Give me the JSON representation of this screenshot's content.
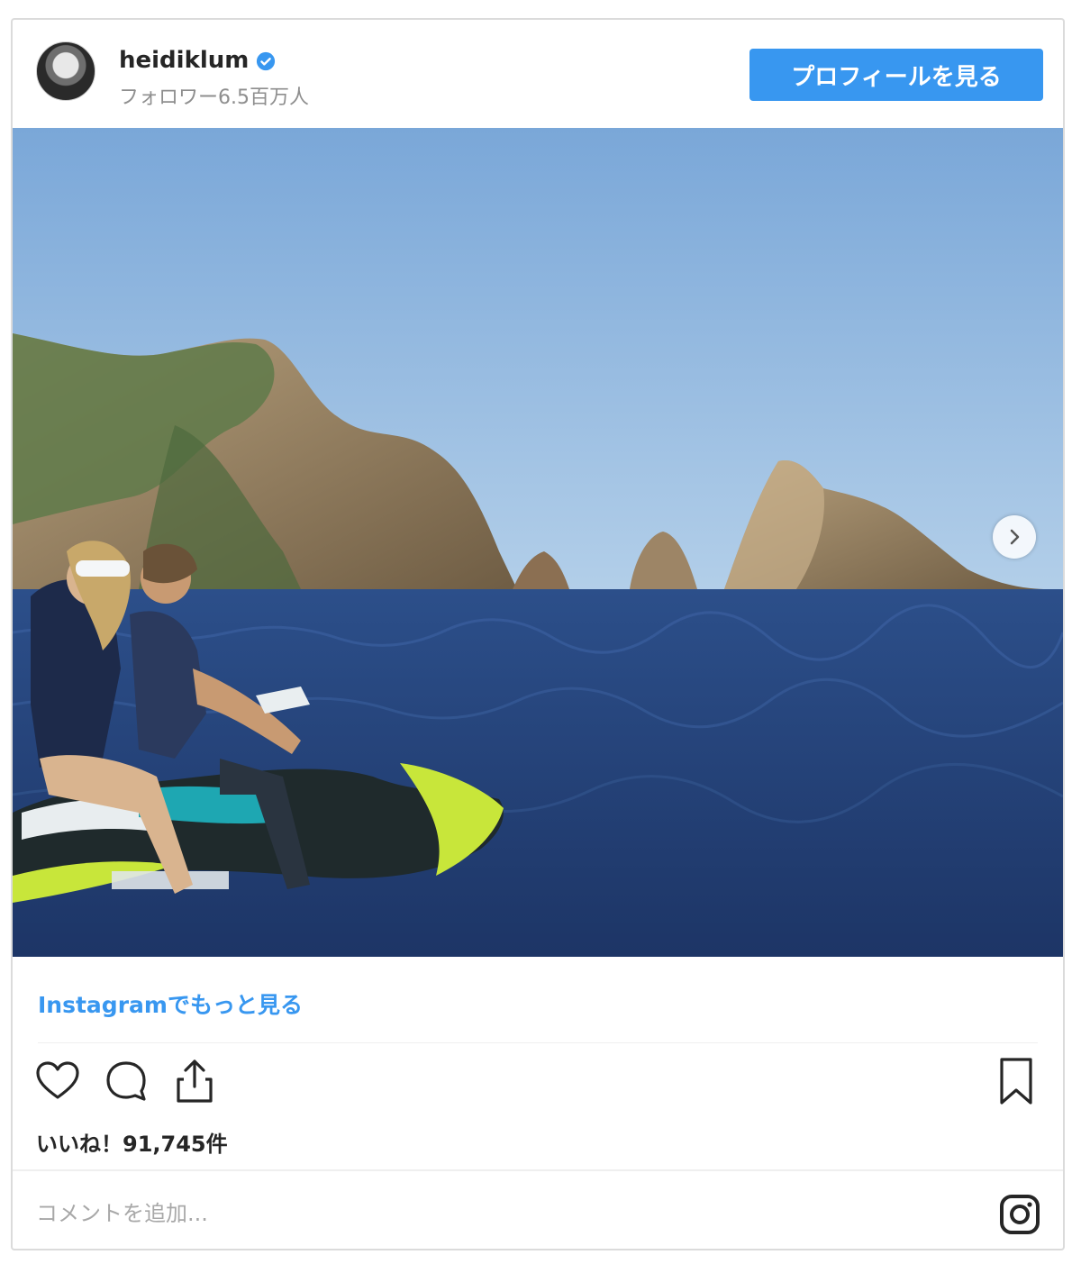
{
  "header": {
    "username": "heidiklum",
    "verified_icon": "verified-badge-icon",
    "followers": "フォロワー6.5百万人",
    "profile_button": "プロフィールを見る"
  },
  "post": {
    "next_icon": "chevron-right-icon",
    "more_link": "Instagramでもっと見る",
    "likes": "いいね！91,745件"
  },
  "actions": {
    "like_icon": "heart-icon",
    "comment_icon": "comment-bubble-icon",
    "share_icon": "share-upload-icon",
    "save_icon": "bookmark-icon"
  },
  "comment": {
    "placeholder": "コメントを追加...",
    "brand_icon": "instagram-logo-icon"
  },
  "colors": {
    "accent": "#3897f0",
    "text": "#262626",
    "muted": "#8e8e8e",
    "border": "#dbdbdb"
  }
}
